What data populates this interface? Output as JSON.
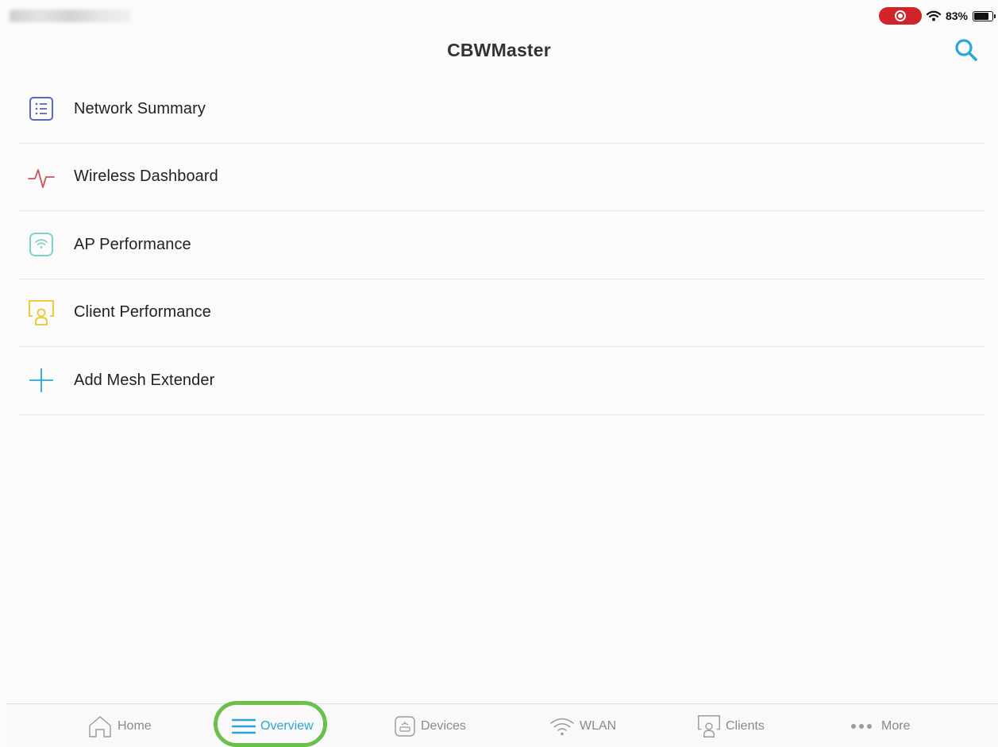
{
  "status_bar": {
    "battery_percent": "83%",
    "battery_level": 0.83,
    "recording": true
  },
  "header": {
    "title": "CBWMaster",
    "search_icon": "search-icon"
  },
  "menu": {
    "items": [
      {
        "label": "Network Summary",
        "icon": "list-icon",
        "icon_color": "#5b6ab8"
      },
      {
        "label": "Wireless Dashboard",
        "icon": "pulse-icon",
        "icon_color": "#d0505a"
      },
      {
        "label": "AP Performance",
        "icon": "wifi-box-icon",
        "icon_color": "#7fd3c6"
      },
      {
        "label": "Client Performance",
        "icon": "client-icon",
        "icon_color": "#eecb3e"
      },
      {
        "label": "Add Mesh Extender",
        "icon": "plus-icon",
        "icon_color": "#2aa7d6"
      }
    ]
  },
  "tab_bar": {
    "tabs": [
      {
        "label": "Home",
        "icon": "home-icon",
        "active": false
      },
      {
        "label": "Overview",
        "icon": "menu-lines-icon",
        "active": true
      },
      {
        "label": "Devices",
        "icon": "device-icon",
        "active": false
      },
      {
        "label": "WLAN",
        "icon": "wifi-icon",
        "active": false
      },
      {
        "label": "Clients",
        "icon": "client-icon",
        "active": false
      },
      {
        "label": "More",
        "icon": "more-dots-icon",
        "active": false
      }
    ]
  },
  "colors": {
    "accent": "#2aa7d6",
    "highlight": "#6cc04a",
    "record": "#d0232a",
    "inactive": "#8a8a8a"
  }
}
